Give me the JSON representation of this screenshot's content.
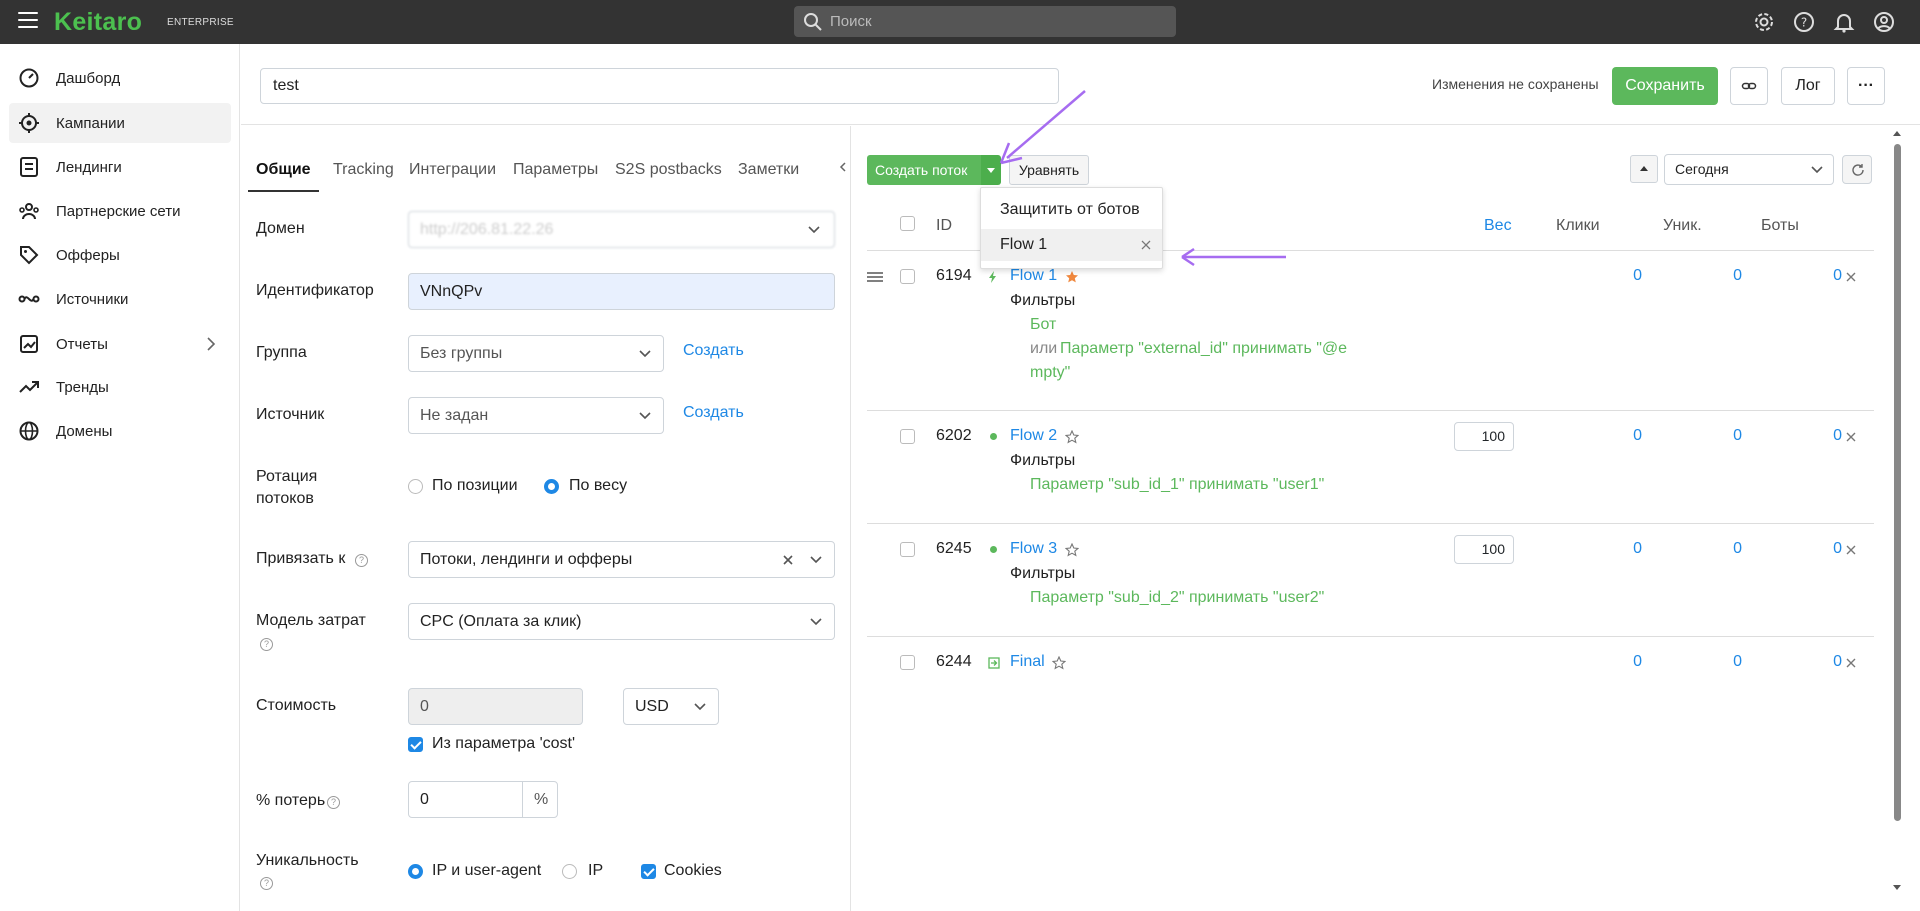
{
  "topbar": {
    "logo": "Keitaro",
    "edition": "ENTERPRISE",
    "search_placeholder": "Поиск",
    "icons": [
      "gear-icon",
      "help-icon",
      "bell-icon",
      "user-icon"
    ]
  },
  "sidebar": {
    "items": [
      {
        "label": "Дашборд",
        "icon": "dashboard-icon"
      },
      {
        "label": "Кампании",
        "icon": "target-icon"
      },
      {
        "label": "Лендинги",
        "icon": "document-icon"
      },
      {
        "label": "Партнерские сети",
        "icon": "users-icon"
      },
      {
        "label": "Офферы",
        "icon": "tags-icon"
      },
      {
        "label": "Источники",
        "icon": "source-icon"
      },
      {
        "label": "Отчеты",
        "icon": "report-icon"
      },
      {
        "label": "Тренды",
        "icon": "trend-icon"
      },
      {
        "label": "Домены",
        "icon": "globe-icon"
      }
    ]
  },
  "header": {
    "campaign_name": "test",
    "unsaved": "Изменения не сохранены",
    "save": "Сохранить",
    "log": "Лог",
    "more": "···"
  },
  "tabs": [
    "Общие",
    "Tracking",
    "Интеграции",
    "Параметры",
    "S2S postbacks",
    "Заметки"
  ],
  "form": {
    "domain_label": "Домен",
    "domain_value": "http://206.81.22.26",
    "id_label": "Идентификатор",
    "id_value": "VNnQPv",
    "group_label": "Группа",
    "group_value": "Без группы",
    "group_create": "Создать",
    "source_label": "Источник",
    "source_value": "Не задан",
    "source_create": "Создать",
    "rotation_label_1": "Ротация",
    "rotation_label_2": "потоков",
    "rotation_opt1": "По позиции",
    "rotation_opt2": "По весу",
    "bind_label": "Привязать к",
    "bind_value": "Потоки, лендинги и офферы",
    "cost_model_label": "Модель затрат",
    "cost_model_value": "CPC (Оплата за клик)",
    "cost_label": "Стоимость",
    "cost_value": "0",
    "currency": "USD",
    "cost_param": "Из параметра 'cost'",
    "loss_label": "% потерь",
    "loss_value": "0",
    "loss_unit": "%",
    "uniq_label": "Уникальность",
    "uniq_opt1": "IP и user-agent",
    "uniq_opt2": "IP",
    "uniq_opt3": "Cookies"
  },
  "streams": {
    "create_btn": "Создать поток",
    "equalize_btn": "Уравнять",
    "period": "Сегодня",
    "columns": {
      "id": "ID",
      "weight": "Вес",
      "clicks": "Клики",
      "unique": "Уник.",
      "bots": "Боты"
    },
    "dropdown": [
      "Защитить от ботов",
      "Flow 1"
    ],
    "filters_label": "Фильтры",
    "rows": [
      {
        "id": "6194",
        "name": "Flow 1",
        "weight": "",
        "clicks": "0",
        "unique": "0",
        "bots": "0",
        "filters": [
          "Бот",
          "или",
          "Параметр \"external_id\"  принимать \"@e",
          "mpty\""
        ]
      },
      {
        "id": "6202",
        "name": "Flow 2",
        "weight": "100",
        "clicks": "0",
        "unique": "0",
        "bots": "0",
        "filters": [
          "Параметр \"sub_id_1\"  принимать \"user1\""
        ]
      },
      {
        "id": "6245",
        "name": "Flow 3",
        "weight": "100",
        "clicks": "0",
        "unique": "0",
        "bots": "0",
        "filters": [
          "Параметр \"sub_id_2\"  принимать \"user2\""
        ]
      },
      {
        "id": "6244",
        "name": "Final",
        "weight": "",
        "clicks": "0",
        "unique": "0",
        "bots": "0",
        "filters": []
      }
    ]
  },
  "colors": {
    "brand": "#4cc04f",
    "accent": "#1e88e5",
    "save": "#5cb85c",
    "annotation": "#a66cf0"
  }
}
